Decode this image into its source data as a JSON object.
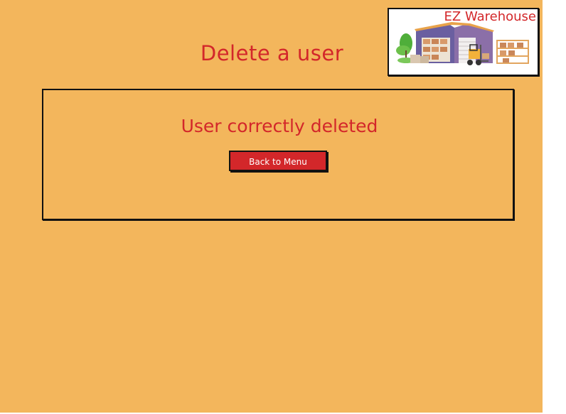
{
  "page": {
    "title": "Delete a user",
    "background_color": "#f3b65c",
    "accent_color": "#d3272a"
  },
  "logo": {
    "text": "EZ Warehouse",
    "icon": "warehouse-illustration"
  },
  "panel": {
    "message": "User correctly deleted",
    "back_button_label": "Back to Menu"
  }
}
